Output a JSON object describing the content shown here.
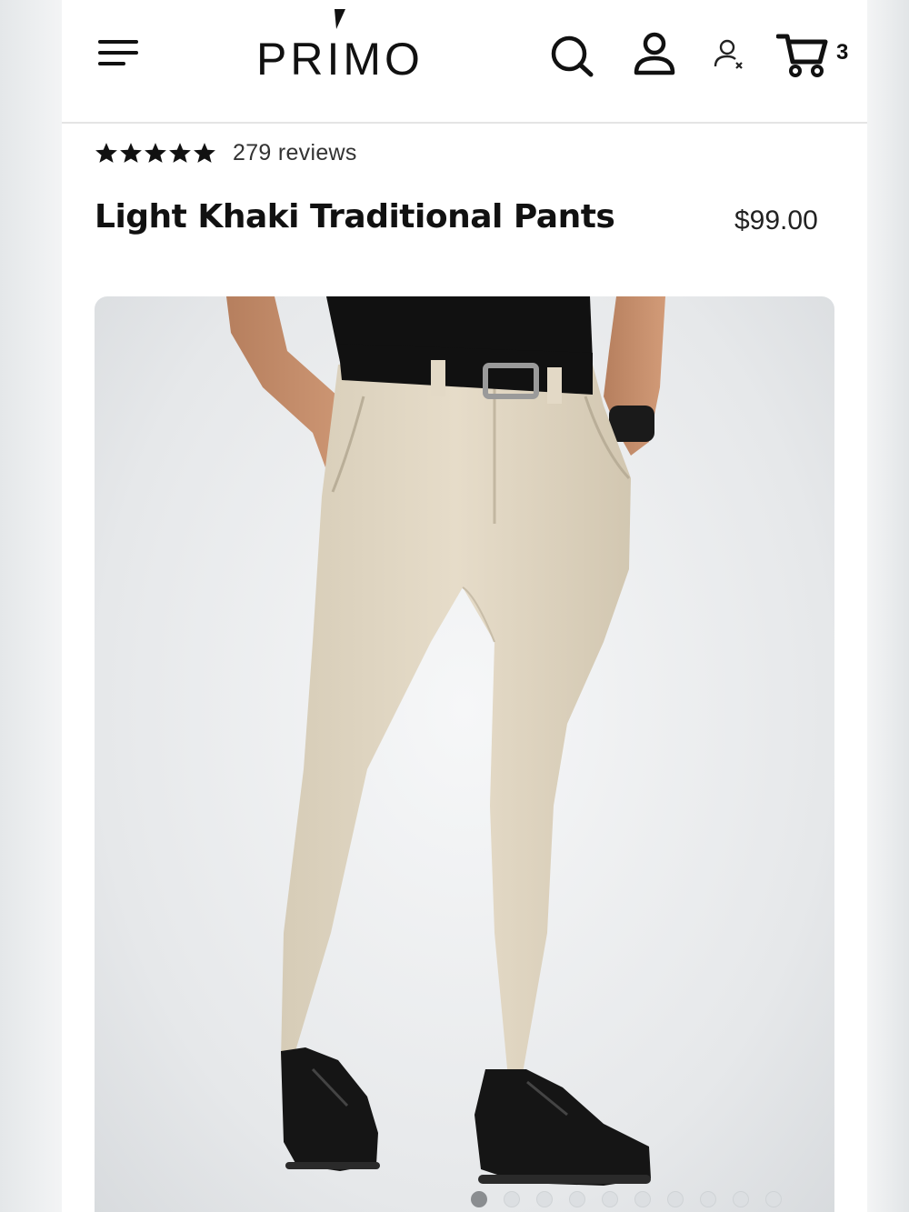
{
  "header": {
    "brand": "PRIMO",
    "cart_count": "3",
    "icons": [
      "menu-icon",
      "search-icon",
      "account-icon",
      "user-x-icon",
      "cart-icon"
    ]
  },
  "product": {
    "rating": 5,
    "review_count": "279 reviews",
    "title": "Light Khaki Traditional Pants",
    "price": "$99.00"
  },
  "gallery": {
    "current_index": 1,
    "total_images": 10
  },
  "colors": {
    "text": "#111111",
    "pants": "#e3d9c6",
    "shoes": "#151515"
  }
}
